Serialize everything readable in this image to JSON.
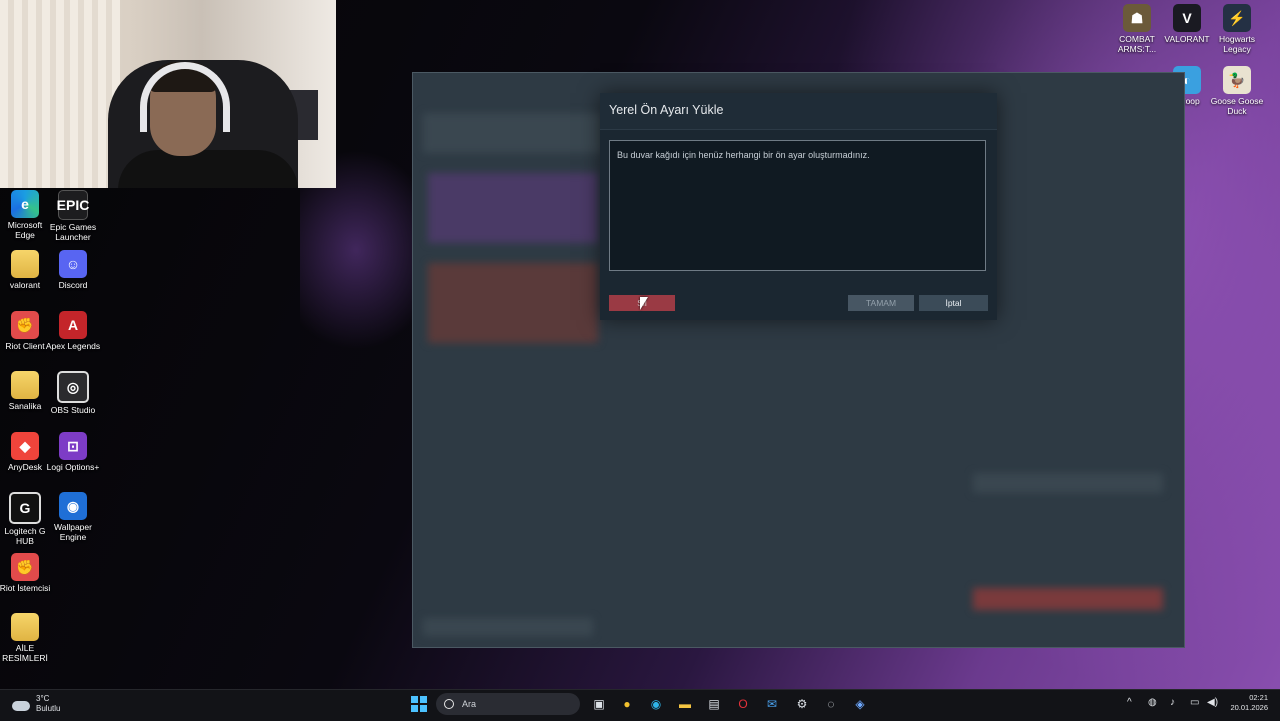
{
  "webcam": {
    "label": "webcam"
  },
  "desktop_left": [
    {
      "label": "Microsoft Edge",
      "glyph": "e",
      "style": "edge"
    },
    {
      "label": "Epic Games Launcher",
      "glyph": "EPIC",
      "style": "epic"
    },
    {
      "label": "valorant",
      "glyph": "",
      "style": "folder"
    },
    {
      "label": "Discord",
      "glyph": "☺",
      "style": "discord"
    },
    {
      "label": "Riot Client",
      "glyph": "✊",
      "style": "riot"
    },
    {
      "label": "Apex Legends",
      "glyph": "A",
      "style": "apex"
    },
    {
      "label": "Sanalika",
      "glyph": "",
      "style": "folder"
    },
    {
      "label": "OBS Studio",
      "glyph": "◎",
      "style": "obs"
    },
    {
      "label": "AnyDesk",
      "glyph": "◆",
      "style": "anydesk"
    },
    {
      "label": "Logi Options+",
      "glyph": "⊡",
      "style": "logi"
    },
    {
      "label": "Logitech G HUB",
      "glyph": "G",
      "style": "ghub"
    },
    {
      "label": "Wallpaper Engine",
      "glyph": "◉",
      "style": "wpe"
    },
    {
      "label": "Riot İstemcisi",
      "glyph": "✊",
      "style": "riot"
    },
    {
      "label": "AİLE RESİMLERİ",
      "glyph": "",
      "style": "folder"
    }
  ],
  "desktop_right": [
    {
      "label": "COMBAT ARMS:T...",
      "glyph": "☗",
      "style": "combat"
    },
    {
      "label": "VALORANT",
      "glyph": "V",
      "style": "valorant"
    },
    {
      "label": "Hogwarts Legacy",
      "glyph": "⚡",
      "style": "hogwarts"
    },
    {
      "label": "neloop",
      "glyph": "◐",
      "style": "medal"
    },
    {
      "label": "Goose Goose Duck",
      "glyph": "🦆",
      "style": "goose"
    }
  ],
  "dialog": {
    "title": "Yerel Ön Ayarı Yükle",
    "message": "Bu duvar kağıdı için henüz herhangi bir ön ayar oluşturmadınız.",
    "delete_label": "Sil",
    "ok_label": "TAMAM",
    "cancel_label": "İptal"
  },
  "taskbar": {
    "weather_temp": "3°C",
    "weather_desc": "Bulutlu",
    "search_placeholder": "Ara",
    "time": "02:21",
    "date": "20.01.2026"
  }
}
